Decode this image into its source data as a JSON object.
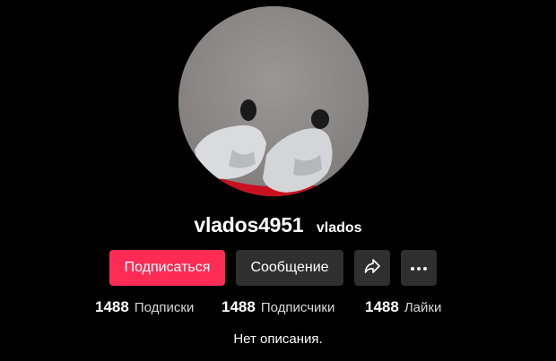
{
  "profile": {
    "username": "vlados4951",
    "nickname": "vlados",
    "bio": "Нет описания."
  },
  "actions": {
    "follow_label": "Подписаться",
    "message_label": "Сообщение",
    "share_icon": "share-arrow-icon",
    "more_icon": "more-dots-icon"
  },
  "stats": [
    {
      "value": "1488",
      "label": "Подписки"
    },
    {
      "value": "1488",
      "label": "Подписчики"
    },
    {
      "value": "1488",
      "label": "Лайки"
    }
  ],
  "colors": {
    "background": "#000000",
    "follow_button": "#fe2c55",
    "secondary_button": "#2f2f2f"
  }
}
